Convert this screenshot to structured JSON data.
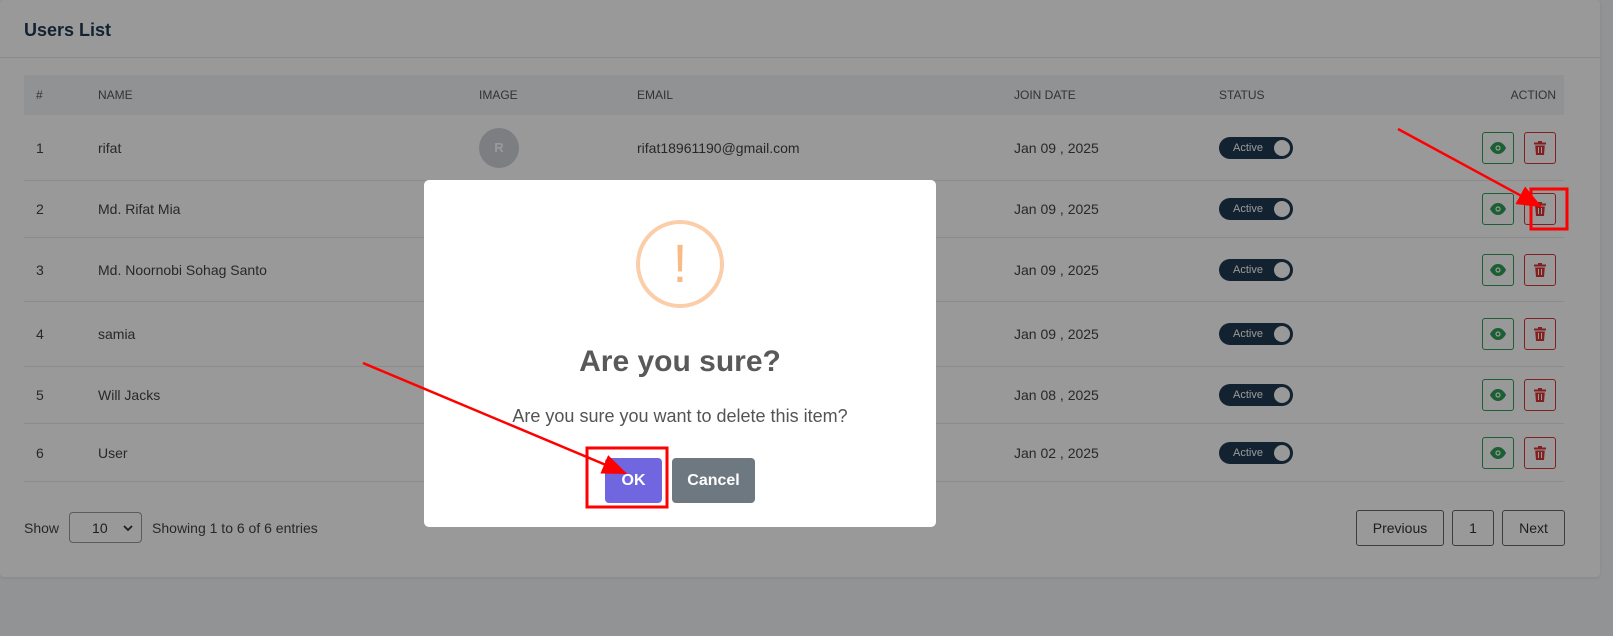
{
  "page": {
    "title": "Users List"
  },
  "table": {
    "headers": {
      "num": "#",
      "name": "NAME",
      "image": "IMAGE",
      "email": "EMAIL",
      "join_date": "JOIN DATE",
      "status": "STATUS",
      "action": "ACTION"
    },
    "rows": [
      {
        "num": "1",
        "name": "rifat",
        "avatar": "R",
        "email": "rifat18961190@gmail.com",
        "join_date": "Jan 09 , 2025",
        "status": "Active"
      },
      {
        "num": "2",
        "name": "Md. Rifat Mia",
        "avatar": "",
        "email": "",
        "join_date": "Jan 09 , 2025",
        "status": "Active"
      },
      {
        "num": "3",
        "name": "Md. Noornobi Sohag Santo",
        "avatar": "",
        "email": "",
        "join_date": "Jan 09 , 2025",
        "status": "Active"
      },
      {
        "num": "4",
        "name": "samia",
        "avatar": "",
        "email": "",
        "join_date": "Jan 09 , 2025",
        "status": "Active"
      },
      {
        "num": "5",
        "name": "Will Jacks",
        "avatar": "",
        "email": "",
        "join_date": "Jan 08 , 2025",
        "status": "Active"
      },
      {
        "num": "6",
        "name": "User",
        "avatar": "",
        "email": "",
        "join_date": "Jan 02 , 2025",
        "status": "Active"
      }
    ]
  },
  "footer": {
    "show_label": "Show",
    "page_size": "10",
    "entries_text": "Showing 1 to 6 of 6 entries",
    "previous": "Previous",
    "current_page": "1",
    "next": "Next"
  },
  "dialog": {
    "icon": "!",
    "title": "Are you sure?",
    "message": "Are you sure you want to delete this item?",
    "ok_label": "OK",
    "cancel_label": "Cancel"
  },
  "colors": {
    "accent": "#7066e0",
    "cancel": "#6e7881",
    "warning": "#f8bb86",
    "toggle": "#1f3a52",
    "view": "#2e9e54",
    "delete": "#d93636",
    "annotation": "#ff0000"
  },
  "icons": {
    "view": "eye-icon",
    "delete": "trash-icon",
    "dropdown": "chevron-down-icon",
    "warning": "exclamation-icon"
  }
}
